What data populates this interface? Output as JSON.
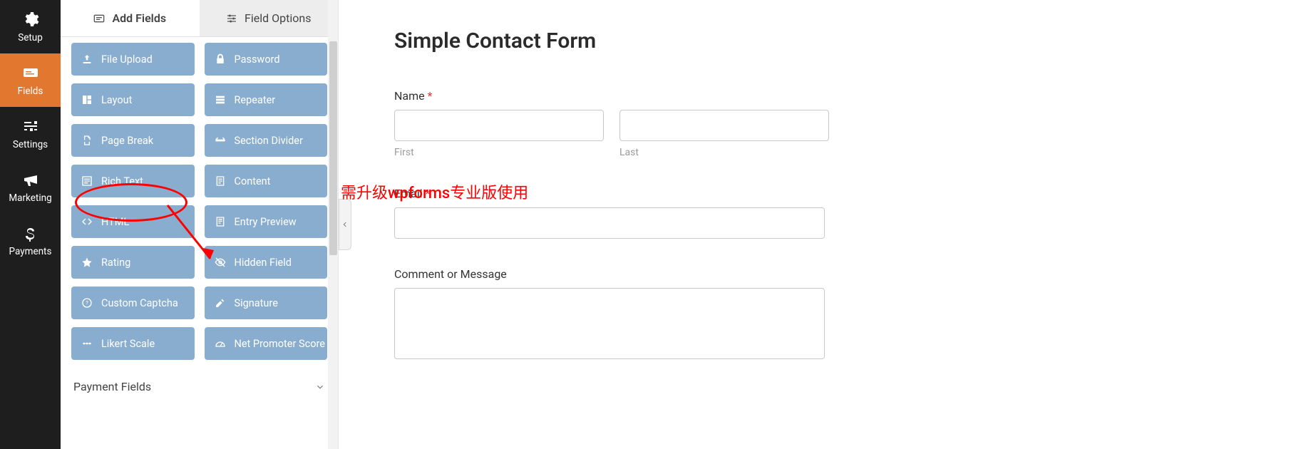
{
  "leftNav": {
    "items": [
      {
        "label": "Setup",
        "icon": "gear"
      },
      {
        "label": "Fields",
        "icon": "form"
      },
      {
        "label": "Settings",
        "icon": "sliders"
      },
      {
        "label": "Marketing",
        "icon": "megaphone"
      },
      {
        "label": "Payments",
        "icon": "dollar"
      }
    ],
    "activeIndex": 1
  },
  "panelTabs": {
    "addFields": "Add Fields",
    "fieldOptions": "Field Options",
    "activeIndex": 0
  },
  "fieldButtons": [
    {
      "label": "File Upload",
      "icon": "upload"
    },
    {
      "label": "Password",
      "icon": "lock"
    },
    {
      "label": "Layout",
      "icon": "layout"
    },
    {
      "label": "Repeater",
      "icon": "repeater"
    },
    {
      "label": "Page Break",
      "icon": "pagebreak"
    },
    {
      "label": "Section Divider",
      "icon": "divider"
    },
    {
      "label": "Rich Text",
      "icon": "richtext"
    },
    {
      "label": "Content",
      "icon": "content"
    },
    {
      "label": "HTML",
      "icon": "code"
    },
    {
      "label": "Entry Preview",
      "icon": "preview"
    },
    {
      "label": "Rating",
      "icon": "star"
    },
    {
      "label": "Hidden Field",
      "icon": "hidden"
    },
    {
      "label": "Custom Captcha",
      "icon": "captcha"
    },
    {
      "label": "Signature",
      "icon": "signature"
    },
    {
      "label": "Likert Scale",
      "icon": "likert"
    },
    {
      "label": "Net Promoter Score",
      "icon": "nps"
    }
  ],
  "sectionLabel": "Payment Fields",
  "form": {
    "title": "Simple Contact Form",
    "nameLabel": "Name",
    "firstSub": "First",
    "lastSub": "Last",
    "emailLabel": "Email",
    "commentLabel": "Comment or Message"
  },
  "annotation": {
    "text": "需升级wpforms专业版使用"
  },
  "colors": {
    "accent": "#e27730",
    "fieldBtn": "#89adce"
  }
}
